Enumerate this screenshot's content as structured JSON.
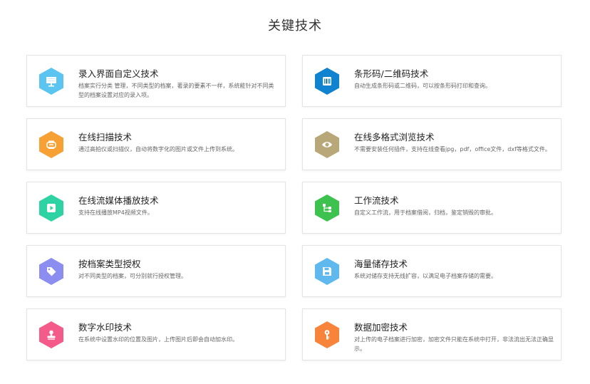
{
  "page": {
    "title": "关键技术"
  },
  "cards": [
    {
      "title": "录入界面自定义技术",
      "desc": "档案实行分类 管理，不同类型的档案，著录的要素不一样，系统能针对不同类型的档案设置对应的录入项。",
      "color": "#5bc4f1",
      "icon": "monitor-icon"
    },
    {
      "title": "条形码/二维码技术",
      "desc": "自动生成条形码或二维码，可以按条形码打印和查询。",
      "color": "#0f82d0",
      "icon": "barcode-icon"
    },
    {
      "title": "在线扫描技术",
      "desc": "通过高拍仪或扫描仪，自动将数字化的图片或文件上传到系统。",
      "color": "#f7a134",
      "icon": "scanner-icon"
    },
    {
      "title": "在线多格式浏览技术",
      "desc": "不需要安装任何插件，支持在线查看jpg，pdf，office文件，dxf等格式文件。",
      "color": "#b8a779",
      "icon": "eye-icon"
    },
    {
      "title": "在线流媒体播放技术",
      "desc": "支持在线播放MP4视频文件。",
      "color": "#2ed3a3",
      "icon": "play-icon"
    },
    {
      "title": "工作流技术",
      "desc": "自定义工作流，用于档案借阅，归档，鉴定销毁的审批。",
      "color": "#3ec24f",
      "icon": "workflow-icon"
    },
    {
      "title": "按档案类型授权",
      "desc": "对不同类型的档案，可分别就行授权管理。",
      "color": "#8b8df0",
      "icon": "tag-icon"
    },
    {
      "title": "海量储存技术",
      "desc": "系统对储存支持无线扩容，以满足电子档案存储的需要。",
      "color": "#5fb9ee",
      "icon": "save-icon"
    },
    {
      "title": "数字水印技术",
      "desc": "在系统中设置水印的位置及图片，上传图片后即会自动加水印。",
      "color": "#f45a8a",
      "icon": "stamp-icon"
    },
    {
      "title": "数据加密技术",
      "desc": "对上传的电子档案进行加密，加密文件只能在系统中打开，非法流出无法正确显示。",
      "color": "#f7843a",
      "icon": "key-icon"
    }
  ]
}
